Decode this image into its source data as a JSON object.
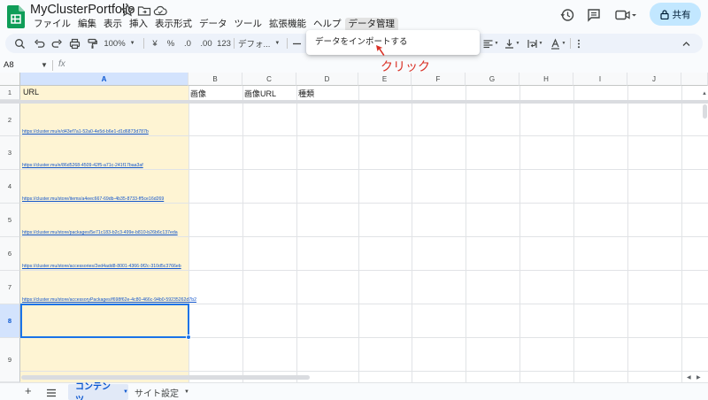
{
  "title_bar": {
    "doc_title": "MyClusterPortfolio",
    "share_label": "共有",
    "icons": [
      "star-icon",
      "move-folder-icon",
      "cloud-status-icon",
      "history-icon",
      "comment-icon",
      "video-call-icon",
      "lock-icon"
    ]
  },
  "menu": {
    "items": [
      "ファイル",
      "編集",
      "表示",
      "挿入",
      "表示形式",
      "データ",
      "ツール",
      "拡張機能",
      "ヘルプ",
      "データ管理"
    ],
    "active_index": 9
  },
  "toolbar": {
    "zoom": "100%",
    "currency": "¥",
    "percent": "%",
    "decrease_decimal": ".0",
    "increase_decimal": ".00",
    "number_format": "123",
    "font_family": "デフォ..."
  },
  "dropdown": {
    "item": "データをインポートする"
  },
  "annotation": {
    "text": "クリック",
    "color": "#d93025"
  },
  "formula_bar": {
    "namebox": "A8",
    "fx": "fx"
  },
  "grid": {
    "columns": [
      "A",
      "B",
      "C",
      "D",
      "E",
      "F",
      "G",
      "H",
      "I",
      "J"
    ],
    "selected_column": "A",
    "rows": [
      "1",
      "2",
      "3",
      "4",
      "5",
      "6",
      "7",
      "8",
      "9"
    ],
    "selected_row": "8",
    "header_row": [
      "URL",
      "画像",
      "画像URL",
      "種類"
    ],
    "urls": [
      "https://cluster.mu/e/d43ef7a1-52a0-4e5d-b6e1-d1d6873d787b",
      "https://cluster.mu/e/86d5268-4509-42f5-a71c-241f17baa3af",
      "https://cluster.mu/store/items/a4eec667-69db-4b35-8733-ff5ce16d269",
      "https://cluster.mu/store/packages/5e71c183-b2c3-499e-b810-b26b6c137eda",
      "https://cluster.mu/store/accessories/2ed4add8-8001-4366-9f2c-310d5c3766eb",
      "https://cluster.mu/store/accessoryPackages/f698f62e-4c80-466c-94b0-59235262d7b2"
    ],
    "column_a_color": "#fef4d3",
    "selection_color": "#1a73e8"
  },
  "sheets": {
    "tabs": [
      "コンテンツ",
      "サイト設定"
    ],
    "active_index": 0
  }
}
